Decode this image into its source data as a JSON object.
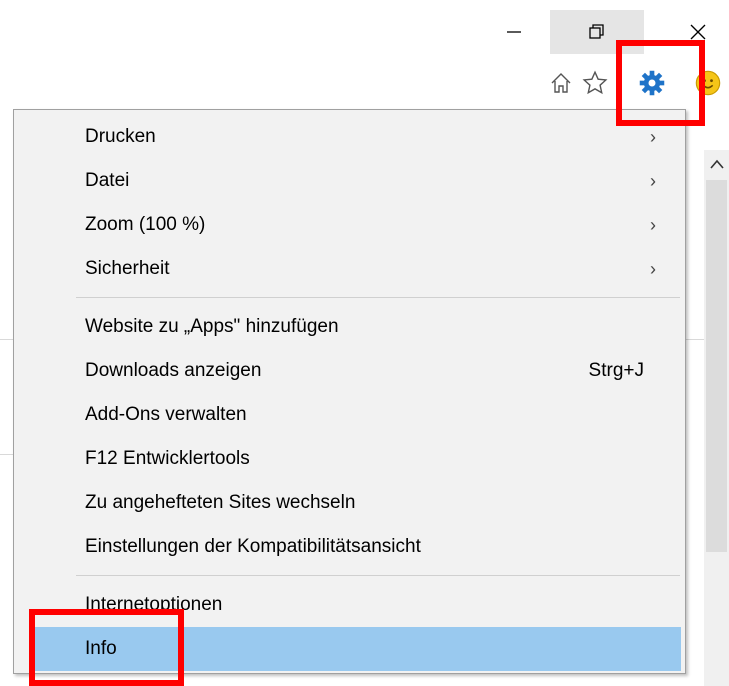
{
  "window": {
    "buttons": {
      "minimize": "minimize-icon",
      "restore": "restore-icon",
      "close": "close-icon"
    }
  },
  "toolbar": {
    "icons": [
      "home-icon",
      "favorites-star-icon",
      "gear-icon",
      "smiley-feedback-icon"
    ],
    "gear_color": "#1e73c8"
  },
  "menu": {
    "items": [
      {
        "label": "Drucken",
        "submenu": true
      },
      {
        "label": "Datei",
        "submenu": true
      },
      {
        "label": "Zoom (100 %)",
        "submenu": true
      },
      {
        "label": "Sicherheit",
        "submenu": true
      },
      {
        "label": "Website zu „Apps\" hinzufügen"
      },
      {
        "label": "Downloads anzeigen",
        "shortcut": "Strg+J"
      },
      {
        "label": "Add-Ons verwalten"
      },
      {
        "label": "F12 Entwicklertools"
      },
      {
        "label": "Zu angehefteten Sites wechseln"
      },
      {
        "label": "Einstellungen der Kompatibilitätsansicht"
      },
      {
        "label": "Internetoptionen"
      },
      {
        "label": "Info",
        "selected": true
      }
    ],
    "arrow": "›",
    "selected_color": "#99c9ef"
  },
  "annotations": {
    "highlight_color": "#ff0000"
  }
}
